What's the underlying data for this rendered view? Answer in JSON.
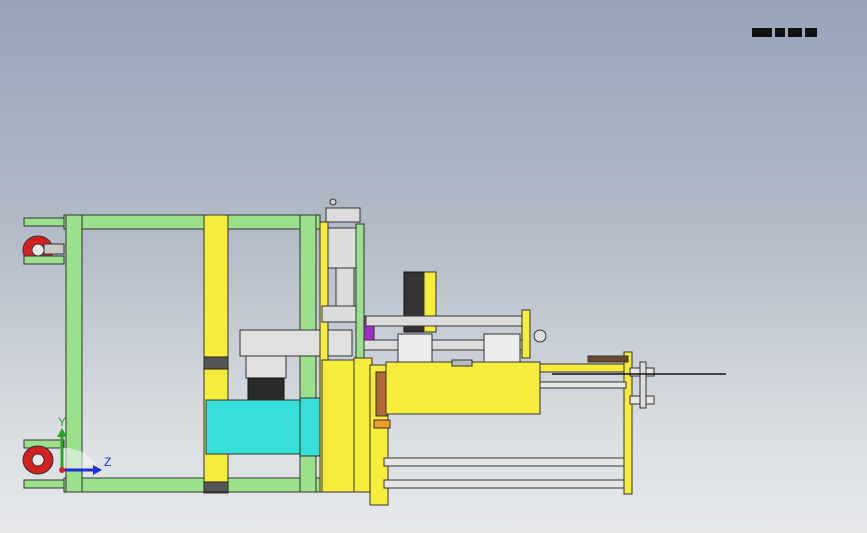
{
  "triad": {
    "y_label": "Y",
    "z_label": "Z"
  },
  "colors": {
    "frame_green": "#9be08a",
    "yellow": "#f5ec3b",
    "cyan": "#36e0d8",
    "red_wheel": "#d42020",
    "steel": "#d8d8d8",
    "dark_metal": "#3a3a3a",
    "bronze": "#b36a3a",
    "purple": "#9d2cc6"
  },
  "icons": {
    "triad": "axis-triad-icon",
    "reference": "view-reference-icon"
  }
}
